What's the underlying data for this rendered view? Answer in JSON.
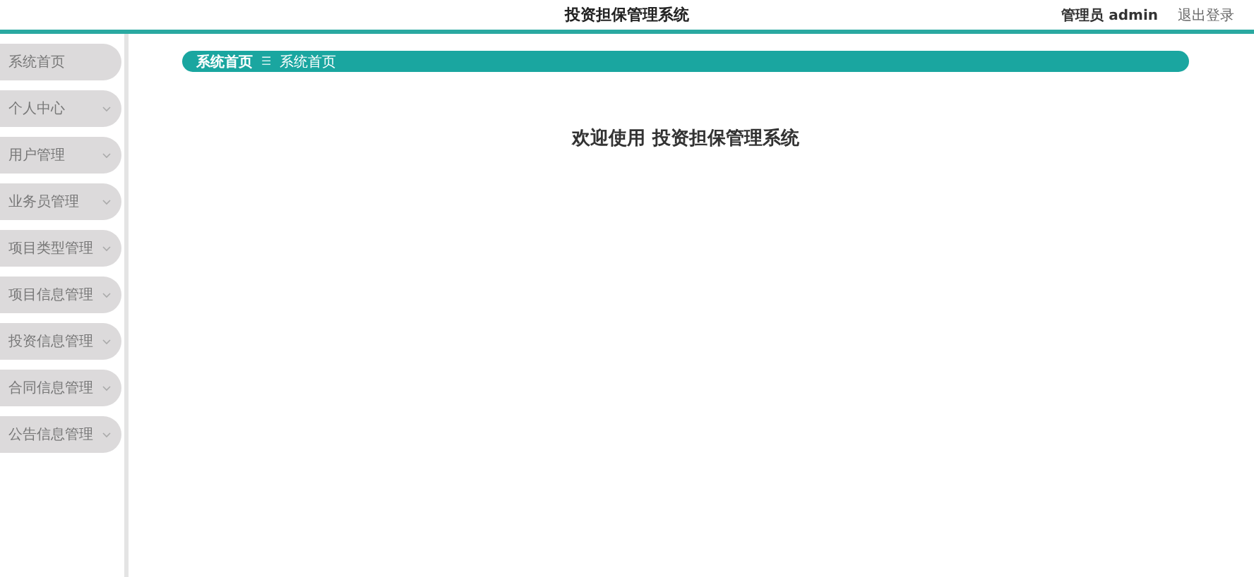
{
  "header": {
    "title": "投资担保管理系统",
    "user": "管理员 admin",
    "logout": "退出登录"
  },
  "sidebar": {
    "items": [
      {
        "label": "系统首页",
        "kind": "link"
      },
      {
        "label": "个人中心",
        "kind": "menu"
      },
      {
        "label": "用户管理",
        "kind": "menu"
      },
      {
        "label": "业务员管理",
        "kind": "menu"
      },
      {
        "label": "项目类型管理",
        "kind": "menu"
      },
      {
        "label": "项目信息管理",
        "kind": "menu"
      },
      {
        "label": "投资信息管理",
        "kind": "menu"
      },
      {
        "label": "合同信息管理",
        "kind": "menu"
      },
      {
        "label": "公告信息管理",
        "kind": "menu"
      }
    ]
  },
  "breadcrumb": {
    "items": [
      "系统首页",
      "系统首页"
    ],
    "separator": "☰"
  },
  "welcome": "欢迎使用 投资担保管理系统"
}
